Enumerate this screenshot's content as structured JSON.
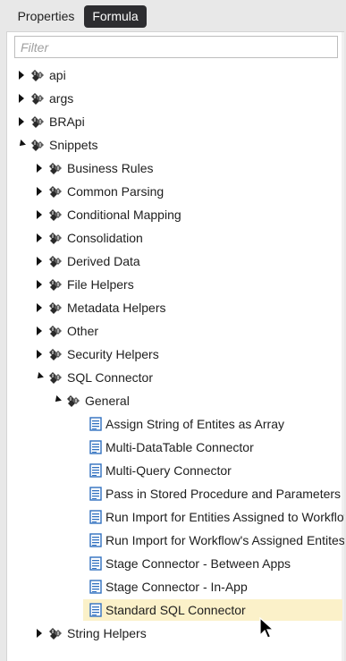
{
  "tabs": {
    "properties": "Properties",
    "formula": "Formula"
  },
  "filter": {
    "placeholder": "Filter",
    "value": ""
  },
  "tree": {
    "api": "api",
    "args": "args",
    "brapi": "BRApi",
    "snippets": "Snippets",
    "business_rules": "Business Rules",
    "common_parsing": "Common Parsing",
    "conditional_mapping": "Conditional Mapping",
    "consolidation": "Consolidation",
    "derived_data": "Derived Data",
    "file_helpers": "File Helpers",
    "metadata_helpers": "Metadata Helpers",
    "other": "Other",
    "security_helpers": "Security Helpers",
    "sql_connector": "SQL Connector",
    "general": "General",
    "assign_string": "Assign String of Entites as Array",
    "multi_datatable": "Multi-DataTable Connector",
    "multi_query": "Multi-Query Connector",
    "pass_in_stored": "Pass in Stored Procedure and Parameters",
    "run_import_entities": "Run Import for Entities Assigned to Workflow",
    "run_import_workflow": "Run Import for Workflow's Assigned Entites",
    "stage_between_apps": "Stage Connector - Between Apps",
    "stage_in_app": "Stage Connector - In-App",
    "standard_sql": "Standard SQL Connector",
    "string_helpers": "String Helpers"
  },
  "colors": {
    "active_tab": "#2d2d30",
    "selection": "#fbf1c9",
    "document_icon": "#2f6fbf"
  },
  "icons": {
    "namespace": "namespace-icon",
    "snippet": "document-icon",
    "cursor": "mouse-pointer-icon"
  }
}
